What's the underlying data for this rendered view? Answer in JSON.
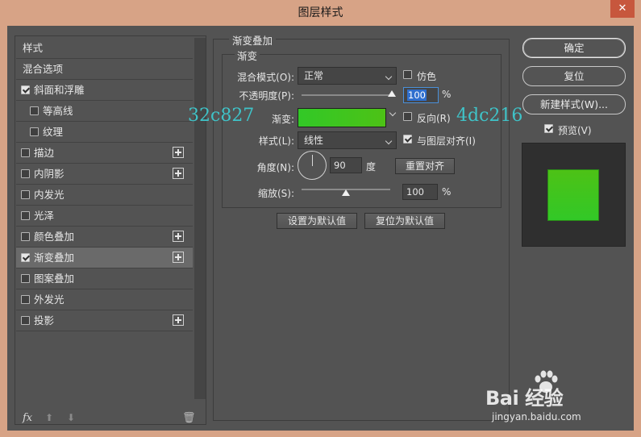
{
  "window": {
    "title": "图层样式",
    "close_label": "✕"
  },
  "styles_list": {
    "items": [
      {
        "label": "样式",
        "checkbox": false,
        "checked": false,
        "plus": false,
        "selected": false,
        "indent": false
      },
      {
        "label": "混合选项",
        "checkbox": false,
        "checked": false,
        "plus": false,
        "selected": false,
        "indent": false
      },
      {
        "label": "斜面和浮雕",
        "checkbox": true,
        "checked": true,
        "plus": false,
        "selected": false,
        "indent": false
      },
      {
        "label": "等高线",
        "checkbox": true,
        "checked": false,
        "plus": false,
        "selected": false,
        "indent": true
      },
      {
        "label": "纹理",
        "checkbox": true,
        "checked": false,
        "plus": false,
        "selected": false,
        "indent": true
      },
      {
        "label": "描边",
        "checkbox": true,
        "checked": false,
        "plus": true,
        "selected": false,
        "indent": false
      },
      {
        "label": "内阴影",
        "checkbox": true,
        "checked": false,
        "plus": true,
        "selected": false,
        "indent": false
      },
      {
        "label": "内发光",
        "checkbox": true,
        "checked": false,
        "plus": false,
        "selected": false,
        "indent": false
      },
      {
        "label": "光泽",
        "checkbox": true,
        "checked": false,
        "plus": false,
        "selected": false,
        "indent": false
      },
      {
        "label": "颜色叠加",
        "checkbox": true,
        "checked": false,
        "plus": true,
        "selected": false,
        "indent": false
      },
      {
        "label": "渐变叠加",
        "checkbox": true,
        "checked": true,
        "plus": true,
        "selected": true,
        "indent": false
      },
      {
        "label": "图案叠加",
        "checkbox": true,
        "checked": false,
        "plus": false,
        "selected": false,
        "indent": false
      },
      {
        "label": "外发光",
        "checkbox": true,
        "checked": false,
        "plus": false,
        "selected": false,
        "indent": false
      },
      {
        "label": "投影",
        "checkbox": true,
        "checked": false,
        "plus": true,
        "selected": false,
        "indent": false
      }
    ],
    "bottom_icons": [
      "fx-icon",
      "arrow-up-icon",
      "arrow-down-icon",
      "trash-icon"
    ],
    "fx_label": "fx"
  },
  "gradient_overlay": {
    "group_title": "渐变叠加",
    "inner_title": "渐变",
    "blend_mode_label": "混合模式(O):",
    "blend_mode_value": "正常",
    "dither_label": "仿色",
    "dither_checked": false,
    "opacity_label": "不透明度(P):",
    "opacity_value": "100",
    "opacity_unit": "%",
    "opacity_fraction": 1.0,
    "gradient_label": "渐变:",
    "gradient_start_color": "#32c827",
    "gradient_end_color": "#4dc216",
    "start_color_text": "32c827",
    "end_color_text": "4dc216",
    "reverse_label": "反向(R)",
    "reverse_checked": false,
    "style_label": "样式(L):",
    "style_value": "线性",
    "align_label": "与图层对齐(I)",
    "align_checked": true,
    "angle_label": "角度(N):",
    "angle_value": "90",
    "angle_unit": "度",
    "reset_align_label": "重置对齐",
    "scale_label": "缩放(S):",
    "scale_value": "100",
    "scale_unit": "%",
    "scale_fraction": 0.5,
    "set_default_label": "设置为默认值",
    "reset_default_label": "复位为默认值"
  },
  "right_panel": {
    "ok_label": "确定",
    "reset_label": "复位",
    "new_style_label": "新建样式(W)...",
    "preview_label": "预览(V)",
    "preview_checked": true
  },
  "watermark": {
    "main": "Bai 经验",
    "sub": "jingyan.baidu.com"
  },
  "colors": {
    "dialog_bg": "#535353",
    "titlebar_bg": "#d7a386",
    "close_button": "#c7573d",
    "overlay_text": "#3fc3c8",
    "selection_bg": "#6a6a6a"
  }
}
